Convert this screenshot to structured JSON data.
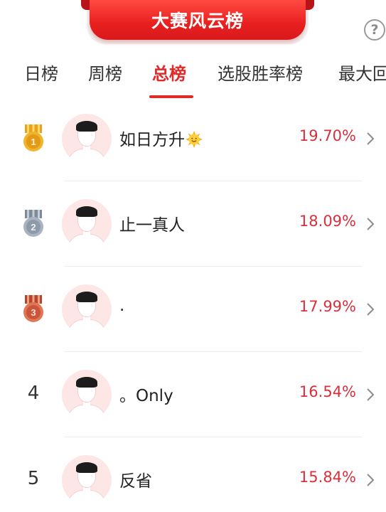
{
  "header": {
    "title": "大赛风云榜",
    "help_label": "?"
  },
  "tabs": [
    {
      "label": "日榜",
      "active": false
    },
    {
      "label": "周榜",
      "active": false
    },
    {
      "label": "总榜",
      "active": true
    },
    {
      "label": "选股胜率榜",
      "active": false
    },
    {
      "label": "最大回",
      "active": false
    }
  ],
  "ranking": [
    {
      "rank": "1",
      "medal": "gold-medal-icon",
      "name": "如日方升",
      "emoji": "sun-face-icon",
      "rate": "19.70%"
    },
    {
      "rank": "2",
      "medal": "silver-medal-icon",
      "name": "止一真人",
      "rate": "18.09%"
    },
    {
      "rank": "3",
      "medal": "bronze-medal-icon",
      "name": ".",
      "rate": "17.99%"
    },
    {
      "rank": "4",
      "name": "。Only",
      "rate": "16.54%"
    },
    {
      "rank": "5",
      "name": "反省",
      "rate": "15.84%"
    }
  ],
  "colors": {
    "accent": "#e12a2a",
    "rate": "#d8303a",
    "gold": "#e7a21e",
    "silver": "#8e9aa8",
    "bronze": "#c9553b"
  }
}
